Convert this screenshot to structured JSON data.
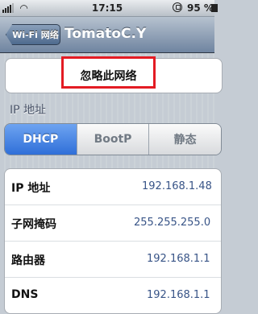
{
  "status_bar": {
    "time": "17:15",
    "battery": "95 %"
  },
  "nav": {
    "back_label": "Wi-Fi 网络",
    "title": "TomatoC.Y"
  },
  "forget": {
    "label": "忽略此网络"
  },
  "ip_section": {
    "label": "IP 地址",
    "segments": [
      "DHCP",
      "BootP",
      "静态"
    ],
    "selected": "DHCP"
  },
  "rows": [
    {
      "key": "IP 地址",
      "value": "192.168.1.48"
    },
    {
      "key": "子网掩码",
      "value": "255.255.255.0"
    },
    {
      "key": "路由器",
      "value": "192.168.1.1"
    },
    {
      "key": "DNS",
      "value": "192.168.1.1"
    }
  ],
  "colors": {
    "accent_blue": "#2f6fd8",
    "highlight_red": "#e31b23"
  }
}
